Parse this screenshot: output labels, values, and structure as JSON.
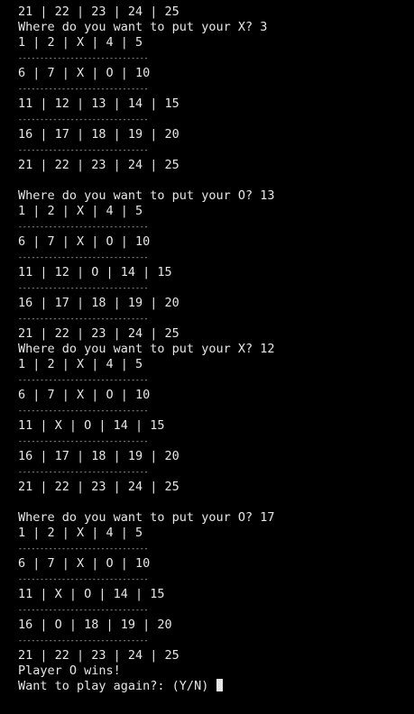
{
  "terminal": {
    "lines": [
      {
        "type": "sep",
        "text": "------------------------------"
      },
      {
        "type": "text",
        "text": "21 | 22 | 23 | 24 | 25"
      },
      {
        "type": "text",
        "text": "Where do you want to put your X? 3"
      },
      {
        "type": "text",
        "text": "1 | 2 | X | 4 | 5"
      },
      {
        "type": "sep",
        "text": "------------------------------"
      },
      {
        "type": "text",
        "text": "6 | 7 | X | O | 10"
      },
      {
        "type": "sep",
        "text": "------------------------------"
      },
      {
        "type": "text",
        "text": "11 | 12 | 13 | 14 | 15"
      },
      {
        "type": "sep",
        "text": "------------------------------"
      },
      {
        "type": "text",
        "text": "16 | 17 | 18 | 19 | 20"
      },
      {
        "type": "sep",
        "text": "------------------------------"
      },
      {
        "type": "text",
        "text": "21 | 22 | 23 | 24 | 25"
      },
      {
        "type": "text",
        "text": ""
      },
      {
        "type": "text",
        "text": "Where do you want to put your O? 13"
      },
      {
        "type": "text",
        "text": "1 | 2 | X | 4 | 5"
      },
      {
        "type": "sep",
        "text": "------------------------------"
      },
      {
        "type": "text",
        "text": "6 | 7 | X | O | 10"
      },
      {
        "type": "sep",
        "text": "------------------------------"
      },
      {
        "type": "text",
        "text": "11 | 12 | O | 14 | 15"
      },
      {
        "type": "sep",
        "text": "------------------------------"
      },
      {
        "type": "text",
        "text": "16 | 17 | 18 | 19 | 20"
      },
      {
        "type": "sep",
        "text": "------------------------------"
      },
      {
        "type": "text",
        "text": "21 | 22 | 23 | 24 | 25"
      },
      {
        "type": "text",
        "text": "Where do you want to put your X? 12"
      },
      {
        "type": "text",
        "text": "1 | 2 | X | 4 | 5"
      },
      {
        "type": "sep",
        "text": "------------------------------"
      },
      {
        "type": "text",
        "text": "6 | 7 | X | O | 10"
      },
      {
        "type": "sep",
        "text": "------------------------------"
      },
      {
        "type": "text",
        "text": "11 | X | O | 14 | 15"
      },
      {
        "type": "sep",
        "text": "------------------------------"
      },
      {
        "type": "text",
        "text": "16 | 17 | 18 | 19 | 20"
      },
      {
        "type": "sep",
        "text": "------------------------------"
      },
      {
        "type": "text",
        "text": "21 | 22 | 23 | 24 | 25"
      },
      {
        "type": "text",
        "text": ""
      },
      {
        "type": "text",
        "text": "Where do you want to put your O? 17"
      },
      {
        "type": "text",
        "text": "1 | 2 | X | 4 | 5"
      },
      {
        "type": "sep",
        "text": "------------------------------"
      },
      {
        "type": "text",
        "text": "6 | 7 | X | O | 10"
      },
      {
        "type": "sep",
        "text": "------------------------------"
      },
      {
        "type": "text",
        "text": "11 | X | O | 14 | 15"
      },
      {
        "type": "sep",
        "text": "------------------------------"
      },
      {
        "type": "text",
        "text": "16 | O | 18 | 19 | 20"
      },
      {
        "type": "sep",
        "text": "------------------------------"
      },
      {
        "type": "text",
        "text": "21 | 22 | 23 | 24 | 25"
      },
      {
        "type": "text",
        "text": "Player O wins!"
      },
      {
        "type": "prompt",
        "text": "Want to play again?: (Y/N) "
      }
    ]
  },
  "colors": {
    "background": "#000000",
    "foreground": "#e6e6e6",
    "cursor": "#e6e6e6"
  }
}
